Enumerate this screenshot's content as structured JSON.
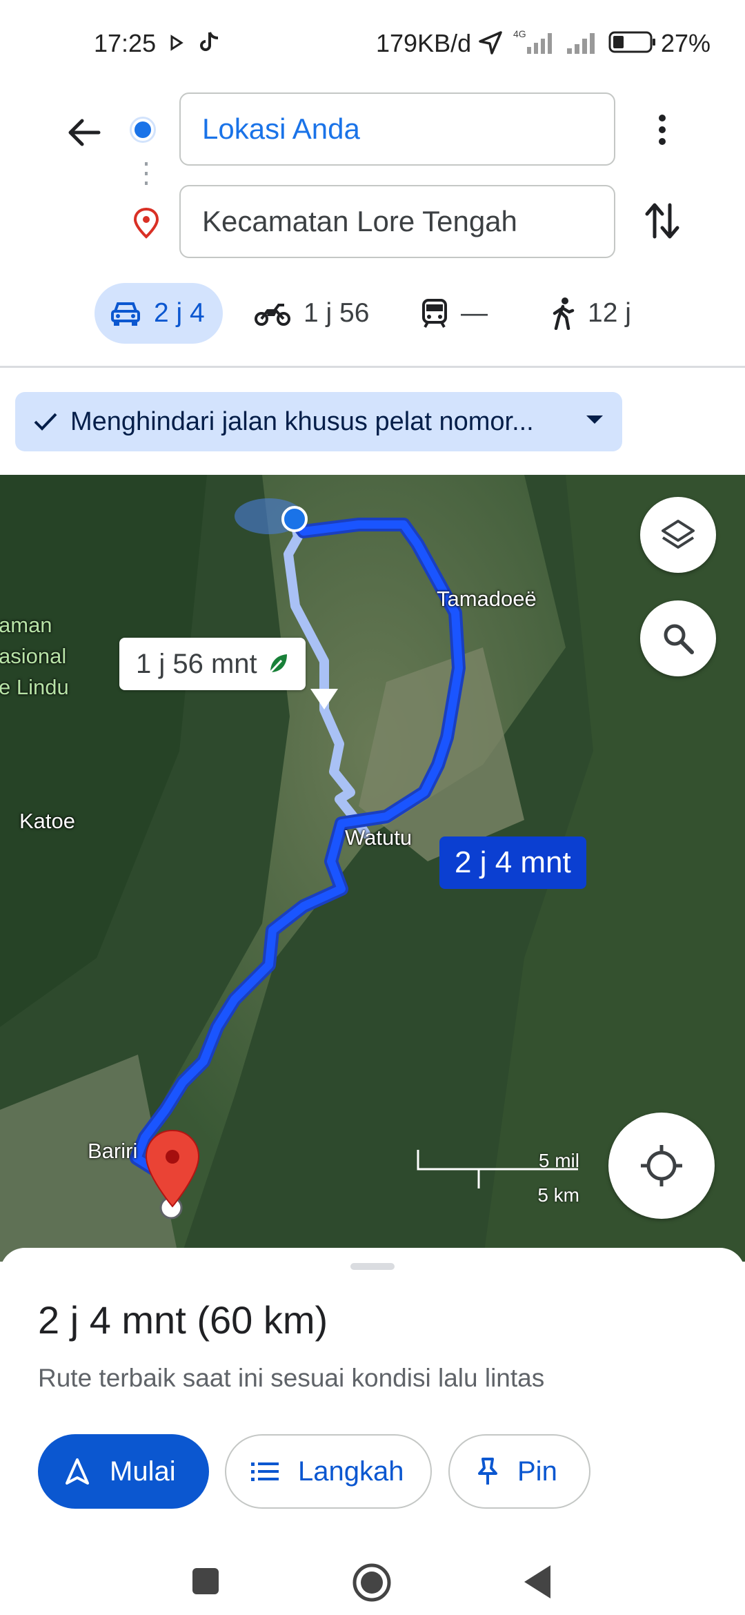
{
  "status_bar": {
    "time": "17:25",
    "data_rate": "179KB/d",
    "network": "4G",
    "battery_percent": "27%"
  },
  "search": {
    "origin": "Lokasi Anda",
    "destination": "Kecamatan Lore Tengah"
  },
  "modes": [
    {
      "name": "car",
      "label": "2 j 4",
      "active": true
    },
    {
      "name": "motorcycle",
      "label": "1 j 56",
      "active": false
    },
    {
      "name": "transit",
      "label": "—",
      "active": false
    },
    {
      "name": "walk",
      "label": "12 j",
      "active": false
    }
  ],
  "option_chip": {
    "label": "Menghindari jalan khusus pelat nomor..."
  },
  "map": {
    "places": {
      "park_line1": "aman",
      "park_line2": "asional",
      "park_line3": "e Lindu",
      "katoe": "Katoe",
      "tamadoee": "Tamadoeë",
      "watutu": "Watutu",
      "bariri": "Bariri"
    },
    "alt_route_label": "1 j 56 mnt",
    "main_route_label": "2 j 4 mnt",
    "scale": {
      "imperial": "5 mil",
      "metric": "5 km"
    },
    "route_color": "#1a55ff",
    "alt_route_color": "#a9c1f5"
  },
  "sheet": {
    "summary": "2 j 4 mnt (60 km)",
    "subtitle": "Rute terbaik saat ini sesuai kondisi lalu lintas",
    "start_label": "Mulai",
    "steps_label": "Langkah",
    "pin_label": "Pin"
  }
}
